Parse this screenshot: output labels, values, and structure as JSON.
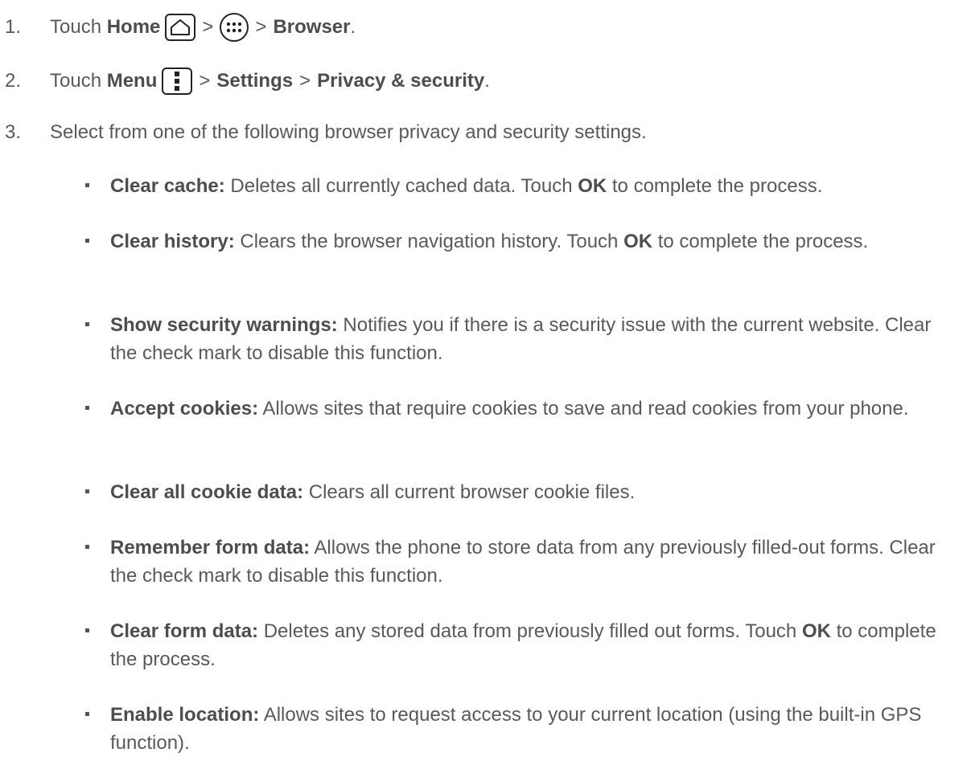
{
  "steps": [
    {
      "number": "1.",
      "parts": {
        "t1": "Touch ",
        "b1": "Home",
        "sep1": ">",
        "sep2": ">",
        "b2": "Browser",
        "end": "."
      },
      "icons": [
        "home-icon",
        "apps-icon"
      ]
    },
    {
      "number": "2.",
      "parts": {
        "t1": "Touch ",
        "b1": "Menu",
        "sep1": ">",
        "b2": "Settings",
        "sep2": ">",
        "b3": "Privacy & security",
        "end": "."
      },
      "icons": [
        "menu-icon"
      ]
    },
    {
      "number": "3.",
      "text": "Select from one of the following browser privacy and security settings."
    }
  ],
  "settings": [
    {
      "label": "Clear cache:",
      "text_a": " Deletes all currently cached data. Touch ",
      "bold_b": "OK",
      "text_c": " to complete the process."
    },
    {
      "label": "Clear history:",
      "text_a": " Clears the browser navigation history. Touch ",
      "bold_b": "OK",
      "text_c": " to complete the process."
    },
    {
      "label": "Show security warnings:",
      "text_a": " Notifies you if there is a security issue with the current website. Clear the check mark to disable this function.",
      "bold_b": "",
      "text_c": ""
    },
    {
      "label": "Accept cookies:",
      "text_a": " Allows sites that require cookies to save and read cookies from your phone.",
      "bold_b": "",
      "text_c": ""
    },
    {
      "label": "Clear all cookie data:",
      "text_a": " Clears all current browser cookie files.",
      "bold_b": "",
      "text_c": ""
    },
    {
      "label": "Remember form data:",
      "text_a": " Allows the phone to store data from any previously filled-out forms. Clear the check mark to disable this function.",
      "bold_b": "",
      "text_c": ""
    },
    {
      "label": "Clear form data:",
      "text_a": " Deletes any stored data from previously filled out forms. Touch ",
      "bold_b": "OK",
      "text_c": " to complete the process."
    },
    {
      "label": "Enable location:",
      "text_a": " Allows sites to request access to your current location (using the built-in GPS function).",
      "bold_b": "",
      "text_c": ""
    }
  ]
}
